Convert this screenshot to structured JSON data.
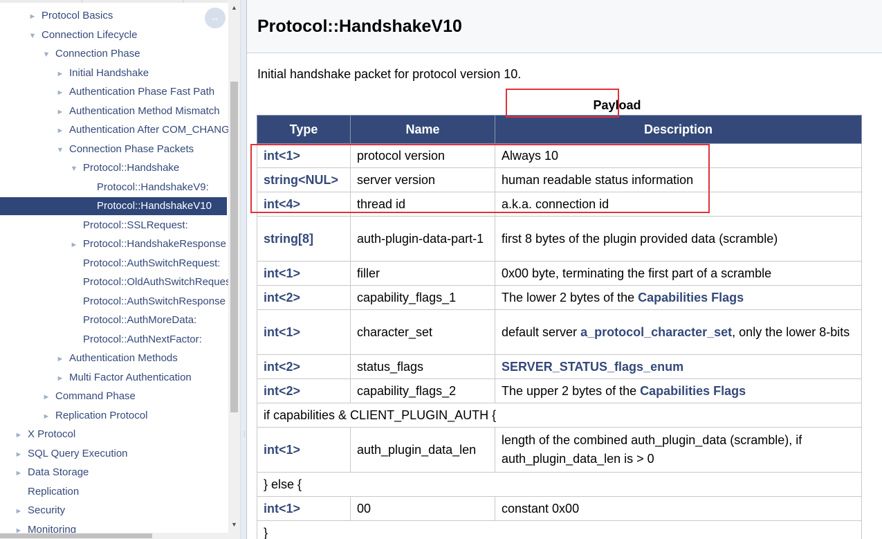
{
  "nav": {
    "items": [
      {
        "label": "Protocol Basics",
        "marker": "►"
      },
      {
        "label": "Connection Lifecycle",
        "marker": "▼"
      },
      {
        "label": "Connection Phase",
        "marker": "▼"
      },
      {
        "label": "Initial Handshake",
        "marker": "►"
      },
      {
        "label": "Authentication Phase Fast Path",
        "marker": "►"
      },
      {
        "label": "Authentication Method Mismatch",
        "marker": "►"
      },
      {
        "label": "Authentication After COM_CHANGE_USER",
        "marker": "►"
      },
      {
        "label": "Connection Phase Packets",
        "marker": "▼"
      },
      {
        "label": "Protocol::Handshake",
        "marker": "▼"
      },
      {
        "label": "Protocol::HandshakeV9:",
        "marker": ""
      },
      {
        "label": "Protocol::HandshakeV10",
        "marker": "",
        "selected": true
      },
      {
        "label": "Protocol::SSLRequest:",
        "marker": ""
      },
      {
        "label": "Protocol::HandshakeResponse",
        "marker": "►"
      },
      {
        "label": "Protocol::AuthSwitchRequest:",
        "marker": ""
      },
      {
        "label": "Protocol::OldAuthSwitchRequest",
        "marker": ""
      },
      {
        "label": "Protocol::AuthSwitchResponse",
        "marker": ""
      },
      {
        "label": "Protocol::AuthMoreData:",
        "marker": ""
      },
      {
        "label": "Protocol::AuthNextFactor:",
        "marker": ""
      },
      {
        "label": "Authentication Methods",
        "marker": "►"
      },
      {
        "label": "Multi Factor Authentication",
        "marker": "►"
      },
      {
        "label": "Command Phase",
        "marker": "►"
      },
      {
        "label": "Replication Protocol",
        "marker": "►"
      },
      {
        "label": "X Protocol",
        "marker": "►"
      },
      {
        "label": "SQL Query Execution",
        "marker": "►"
      },
      {
        "label": "Data Storage",
        "marker": "►"
      },
      {
        "label": "Replication",
        "marker": ""
      },
      {
        "label": "Security",
        "marker": "►"
      },
      {
        "label": "Monitoring",
        "marker": "►"
      }
    ],
    "toggle_glyph": "↔"
  },
  "main": {
    "title": "Protocol::HandshakeV10",
    "intro": "Initial handshake packet for protocol version 10.",
    "caption": "Payload",
    "headers": {
      "type": "Type",
      "name": "Name",
      "description": "Description"
    },
    "rows": {
      "r1": {
        "type": "int<1>",
        "name": "protocol version",
        "desc": "Always 10"
      },
      "r2": {
        "type": "string<NUL>",
        "name": "server version",
        "desc": "human readable status information"
      },
      "r3": {
        "type": "int<4>",
        "name": "thread id",
        "desc": "a.k.a. connection id"
      },
      "r4": {
        "type": "string[8]",
        "name": "auth-plugin-data-part-1",
        "desc": "first 8 bytes of the plugin provided data (scramble)"
      },
      "r5": {
        "type": "int<1>",
        "name": "filler",
        "desc": "0x00 byte, terminating the first part of a scramble"
      },
      "r6": {
        "type": "int<2>",
        "name": "capability_flags_1",
        "desc_pre": "The lower 2 bytes of the ",
        "desc_link": "Capabilities Flags"
      },
      "r7": {
        "type": "int<1>",
        "name": "character_set",
        "desc_pre": "default server ",
        "desc_link": "a_protocol_character_set",
        "desc_post": ", only the lower 8-bits"
      },
      "r8": {
        "type": "int<2>",
        "name": "status_flags",
        "desc_link": "SERVER_STATUS_flags_enum"
      },
      "r9": {
        "type": "int<2>",
        "name": "capability_flags_2",
        "desc_pre": "The upper 2 bytes of the ",
        "desc_link": "Capabilities Flags"
      },
      "cond_if": "if capabilities & CLIENT_PLUGIN_AUTH {",
      "r10": {
        "type": "int<1>",
        "name": "auth_plugin_data_len",
        "desc": "length of the combined auth_plugin_data (scramble), if auth_plugin_data_len is > 0"
      },
      "cond_else": "} else {",
      "r11": {
        "type": "int<1>",
        "name": "00",
        "desc": "constant 0x00"
      },
      "cond_close": "}"
    }
  },
  "colors": {
    "accent": "#34497a",
    "highlight": "#e0303a"
  }
}
